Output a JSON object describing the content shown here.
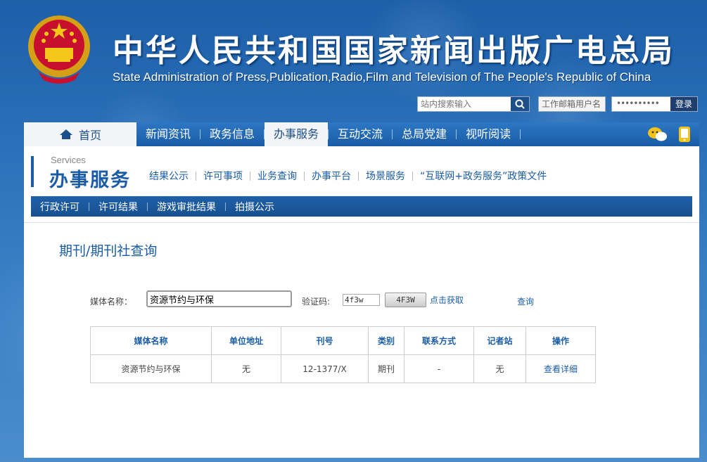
{
  "header": {
    "title_cn": "中华人民共和国国家新闻出版广电总局",
    "title_en": "State Administration of Press,Publication,Radio,Film and Television of The People's Republic of China"
  },
  "search": {
    "placeholder": "站内搜索输入"
  },
  "mail": {
    "username_placeholder": "工作邮箱用户名",
    "password_mask": "••••••••••",
    "login": "登录"
  },
  "nav": {
    "home": "首页",
    "items": [
      "新闻资讯",
      "政务信息",
      "办事服务",
      "互动交流",
      "总局党建",
      "视听阅读"
    ]
  },
  "services": {
    "en": "Services",
    "cn": "办事服务",
    "links": [
      "结果公示",
      "许可事项",
      "业务查询",
      "办事平台",
      "场景服务",
      "“互联网+政务服务”政策文件"
    ]
  },
  "subnav": [
    "行政许可",
    "许可结果",
    "游戏审批结果",
    "拍摄公示"
  ],
  "page": {
    "title": "期刊/期刊社查询"
  },
  "form": {
    "media_label": "媒体名称：",
    "media_value": "资源节约与环保",
    "code_label": "验证码:",
    "code_value": "4f3w",
    "code_image": "4F3W",
    "get_code": "点击获取",
    "query": "查询"
  },
  "table": {
    "headers": [
      "媒体名称",
      "单位地址",
      "刊号",
      "类别",
      "联系方式",
      "记者站",
      "操作"
    ],
    "rows": [
      [
        "资源节约与环保",
        "无",
        "12-1377/X",
        "期刊",
        "-",
        "无",
        "查看详细"
      ]
    ]
  }
}
